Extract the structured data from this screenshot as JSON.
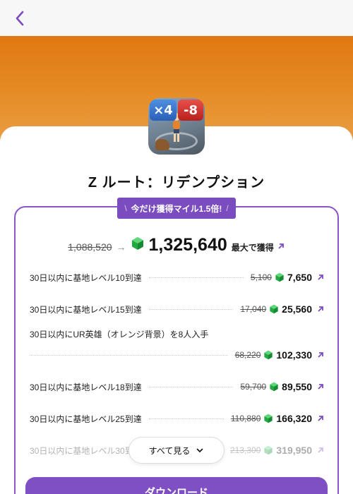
{
  "header": {
    "back_icon": "chevron-left-icon"
  },
  "app": {
    "title": "Z ルート：リデンプション",
    "icon": "game-app-icon",
    "icon_badge_left": "×4",
    "icon_badge_right": "-8"
  },
  "promo": {
    "text": "今だけ獲得マイル1.5倍!",
    "open": "\\",
    "close": "/"
  },
  "total": {
    "old": "1,088,520",
    "value": "1,325,640",
    "suffix": "最大で獲得"
  },
  "tasks": [
    {
      "label": "30日以内に基地レベル10到達",
      "old": "5,100",
      "value": "7,650"
    },
    {
      "label": "30日以内に基地レベル15到達",
      "old": "17,040",
      "value": "25,560"
    },
    {
      "label": "30日以内にUR英雄（オレンジ背景）を8人入手",
      "old": "68,220",
      "value": "102,330"
    },
    {
      "label": "30日以内に基地レベル18到達",
      "old": "59,700",
      "value": "89,550"
    },
    {
      "label": "30日以内に基地レベル25到達",
      "old": "110,880",
      "value": "166,320"
    },
    {
      "label": "30日以内に基地レベル30到達",
      "old": "213,300",
      "value": "319,950"
    }
  ],
  "see_all": "すべて見る",
  "download": "ダウンロード",
  "colors": {
    "accent": "#7a4cc0",
    "hero_orange": "#e58a22",
    "gem_green": "#2db84a"
  }
}
